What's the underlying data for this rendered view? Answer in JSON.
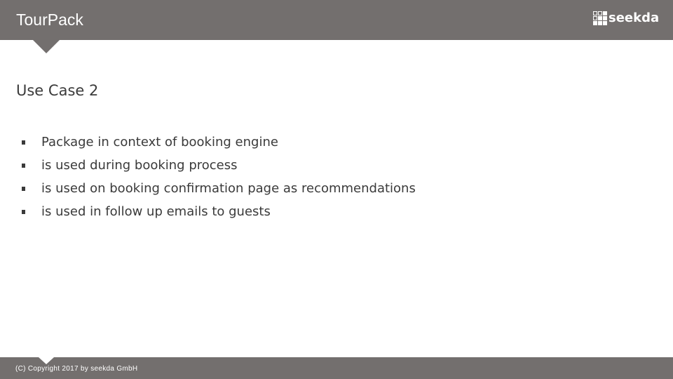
{
  "header": {
    "title": "TourPack",
    "logo": {
      "icon": "grid-logo-icon",
      "text": "seekda"
    }
  },
  "main": {
    "title": "Use Case 2",
    "bullets": [
      "Package in context of booking engine",
      "is used during booking process",
      "is used on booking confirmation page as recommendations",
      "is used in follow up emails to guests"
    ]
  },
  "footer": {
    "copyright": "(C) Copyright 2017 by seekda GmbH"
  },
  "colors": {
    "bar": "#736f6e",
    "text": "#3a3a3a",
    "background": "#ffffff"
  }
}
